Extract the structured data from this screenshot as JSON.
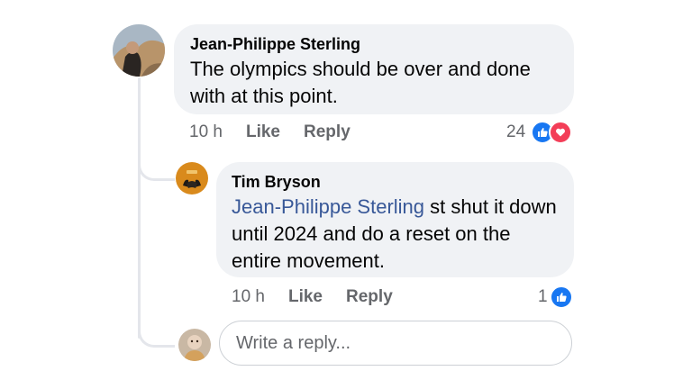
{
  "comment": {
    "author": "Jean-Philippe Sterling",
    "text": "The olympics should be over and done with at this point.",
    "time": "10 h",
    "like_label": "Like",
    "reply_label": "Reply",
    "reaction_count": "24",
    "reactions": [
      "like-icon",
      "love-icon"
    ]
  },
  "reply": {
    "author": "Tim Bryson",
    "mention": "Jean-Philippe Sterling",
    "text": " st shut it down until 2024 and do a reset on the entire movement.",
    "time": "10 h",
    "like_label": "Like",
    "reply_label": "Reply",
    "reaction_count": "1",
    "reactions": [
      "like-icon"
    ]
  },
  "reply_input": {
    "placeholder": "Write a reply..."
  },
  "colors": {
    "bubble": "#f0f2f5",
    "mention": "#385898",
    "like": "#1877f2",
    "love": "#f33e58",
    "meta": "#65676b"
  }
}
